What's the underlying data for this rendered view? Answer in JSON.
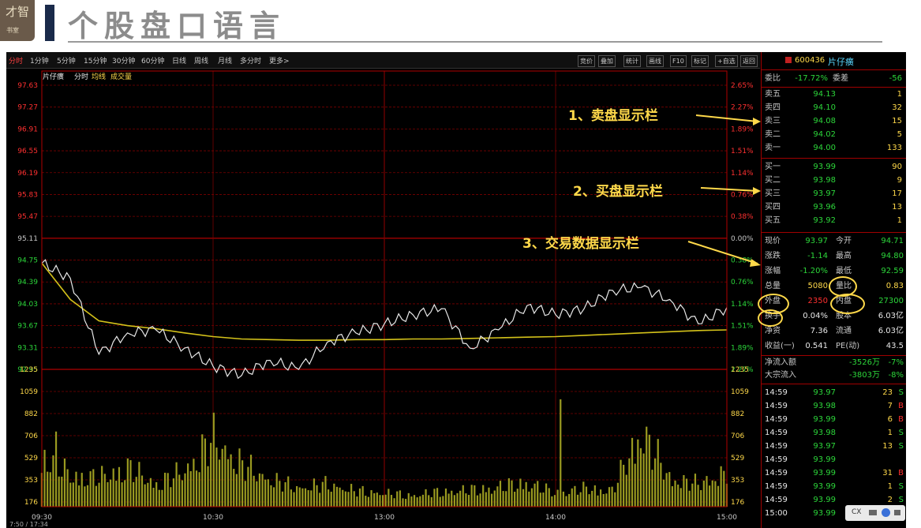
{
  "slide": {
    "logo_text": "才智",
    "logo_sub": "书室",
    "title": "个股盘口语言"
  },
  "toolbar": {
    "periods": [
      "分时",
      "1分钟",
      "5分钟",
      "15分钟",
      "30分钟",
      "60分钟",
      "日线",
      "周线",
      "月线",
      "多分时",
      "更多>"
    ],
    "active_period": "分时",
    "tools": [
      "竞价",
      "叠加",
      "统计",
      "画线",
      "F10",
      "标记",
      "+自选",
      "返回"
    ]
  },
  "chart": {
    "legend": [
      "片仔癀",
      "分时",
      "均线",
      "成交量"
    ],
    "legend_colors": [
      "#e8e8e8",
      "#e8e8e8",
      "#ffd94a",
      "#ffd94a"
    ],
    "price_labels": [
      "97.63",
      "97.27",
      "96.91",
      "96.55",
      "96.19",
      "95.83",
      "95.47",
      "95.11",
      "94.75",
      "94.39",
      "94.03",
      "93.67",
      "93.31",
      "92.95"
    ],
    "pct_labels": [
      "2.65%",
      "2.27%",
      "1.89%",
      "1.51%",
      "1.14%",
      "0.76%",
      "0.38%",
      "0.00%",
      "0.38%",
      "0.76%",
      "1.14%",
      "1.51%",
      "1.89%",
      "2.27%"
    ],
    "volume_labels": [
      "1235",
      "1059",
      "882",
      "706",
      "529",
      "353",
      "176"
    ],
    "time_labels": [
      "09:30",
      "10:30",
      "13:00",
      "14:00",
      "15:00"
    ],
    "colors": {
      "price_line": "#e8e8e8",
      "avg_line": "#d4c21a",
      "volume_bar": "#9a9a20",
      "grid": "#7a0000",
      "up": "#ff3030",
      "down": "#2cd63a"
    }
  },
  "chart_data": {
    "type": "line",
    "x": [
      "09:30",
      "09:40",
      "09:50",
      "10:00",
      "10:10",
      "10:20",
      "10:30",
      "10:40",
      "10:50",
      "11:00",
      "11:10",
      "11:20",
      "11:30/13:00",
      "13:10",
      "13:20",
      "13:30",
      "13:40",
      "13:50",
      "14:00",
      "14:10",
      "14:20",
      "14:30",
      "14:40",
      "14:50",
      "15:00"
    ],
    "series": [
      {
        "name": "分时",
        "values": [
          94.7,
          94.45,
          93.2,
          93.55,
          93.6,
          93.3,
          93.0,
          92.85,
          93.1,
          92.95,
          93.4,
          93.55,
          93.7,
          93.85,
          93.95,
          93.3,
          93.6,
          94.0,
          93.85,
          93.95,
          94.25,
          94.3,
          94.1,
          93.7,
          93.97
        ]
      },
      {
        "name": "均线",
        "values": [
          94.7,
          94.1,
          93.75,
          93.67,
          93.62,
          93.55,
          93.49,
          93.45,
          93.44,
          93.43,
          93.43,
          93.44,
          93.44,
          93.45,
          93.45,
          93.46,
          93.47,
          93.48,
          93.49,
          93.51,
          93.53,
          93.55,
          93.57,
          93.59,
          93.6
        ]
      }
    ],
    "ylim": [
      92.95,
      97.63
    ],
    "volume": {
      "ylim": [
        0,
        1235
      ],
      "values": [
        700,
        420,
        380,
        520,
        300,
        470,
        900,
        560,
        360,
        250,
        300,
        210,
        180,
        150,
        200,
        220,
        260,
        320,
        180,
        240,
        220,
        1000,
        380,
        300,
        460
      ]
    }
  },
  "panel": {
    "stock_code": "600436",
    "stock_name": "片仔癀",
    "weibi": {
      "label": "委比",
      "value": "-17.72%",
      "label2": "委差",
      "value2": "-56"
    },
    "sell": [
      {
        "label": "卖五",
        "price": "94.13",
        "vol": "1"
      },
      {
        "label": "卖四",
        "price": "94.10",
        "vol": "32"
      },
      {
        "label": "卖三",
        "price": "94.08",
        "vol": "15"
      },
      {
        "label": "卖二",
        "price": "94.02",
        "vol": "5"
      },
      {
        "label": "卖一",
        "price": "94.00",
        "vol": "133"
      }
    ],
    "buy": [
      {
        "label": "买一",
        "price": "93.99",
        "vol": "90"
      },
      {
        "label": "买二",
        "price": "93.98",
        "vol": "9"
      },
      {
        "label": "买三",
        "price": "93.97",
        "vol": "17"
      },
      {
        "label": "买四",
        "price": "93.96",
        "vol": "13"
      },
      {
        "label": "买五",
        "price": "93.92",
        "vol": "1"
      }
    ],
    "stats": [
      {
        "l1": "现价",
        "v1": "93.97",
        "l2": "今开",
        "v2": "94.71"
      },
      {
        "l1": "涨跌",
        "v1": "-1.14",
        "l2": "最高",
        "v2": "94.80"
      },
      {
        "l1": "涨幅",
        "v1": "-1.20%",
        "l2": "最低",
        "v2": "92.59"
      },
      {
        "l1": "总量",
        "v1": "5080",
        "l2": "量比",
        "v2": "0.83"
      },
      {
        "l1": "外盘",
        "v1": "2350",
        "l2": "内盘",
        "v2": "27300"
      },
      {
        "l1": "换手",
        "v1": "0.04%",
        "l2": "股本",
        "v2": "6.03亿"
      },
      {
        "l1": "净资",
        "v1": "7.36",
        "l2": "流通",
        "v2": "6.03亿"
      },
      {
        "l1": "收益(一)",
        "v1": "0.541",
        "l2": "PE(动)",
        "v2": "43.5"
      }
    ],
    "flows": [
      {
        "label": "净流入额",
        "value": "-3526万",
        "pct": "-7%"
      },
      {
        "label": "大宗流入",
        "value": "-3803万",
        "pct": "-8%"
      }
    ],
    "ticks": [
      {
        "time": "14:59",
        "price": "93.97",
        "vol": "23",
        "side": "S"
      },
      {
        "time": "14:59",
        "price": "93.98",
        "vol": "7",
        "side": "B"
      },
      {
        "time": "14:59",
        "price": "93.99",
        "vol": "6",
        "side": "B"
      },
      {
        "time": "14:59",
        "price": "93.98",
        "vol": "1",
        "side": "S"
      },
      {
        "time": "14:59",
        "price": "93.97",
        "vol": "13",
        "side": "S"
      },
      {
        "time": "14:59",
        "price": "93.99",
        "vol": "",
        "side": ""
      },
      {
        "time": "14:59",
        "price": "93.99",
        "vol": "31",
        "side": "B"
      },
      {
        "time": "14:59",
        "price": "93.99",
        "vol": "1",
        "side": "S"
      },
      {
        "time": "14:59",
        "price": "93.99",
        "vol": "2",
        "side": "S"
      },
      {
        "time": "15:00",
        "price": "93.99",
        "vol": "1",
        "side": "S"
      }
    ]
  },
  "annotations": [
    "1、卖盘显示栏",
    "2、买盘显示栏",
    "3、交易数据显示栏"
  ],
  "video_controls": {
    "label": "CX"
  },
  "time_readout": "7:50 / 17:34"
}
